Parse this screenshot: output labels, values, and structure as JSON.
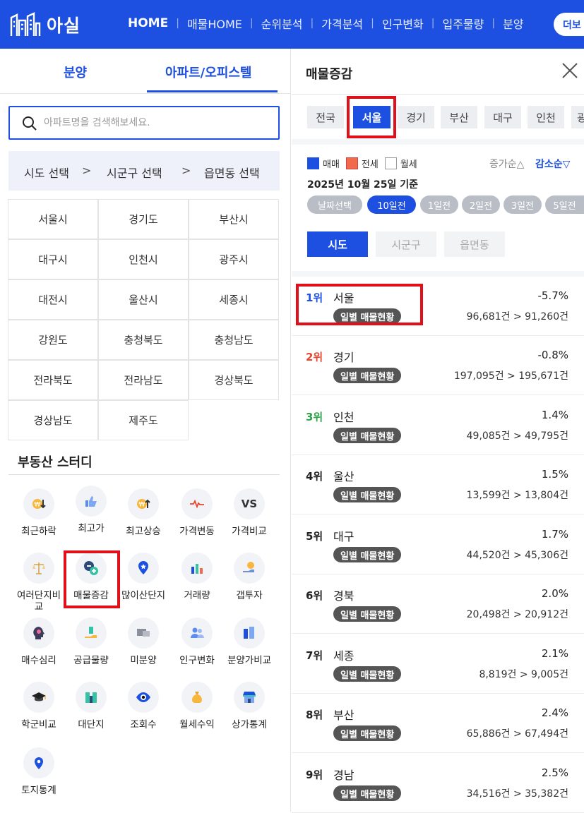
{
  "header": {
    "logo_text": "아실",
    "nav": [
      "HOME",
      "매물HOME",
      "순위분석",
      "가격분석",
      "인구변화",
      "입주물량",
      "분양"
    ],
    "more_label": "더보"
  },
  "left": {
    "tabs": [
      "분양",
      "아파트/오피스텔"
    ],
    "search_placeholder": "아파트명을 검색해보세요.",
    "region_steps": [
      "시도 선택",
      "시군구 선택",
      "읍면동 선택"
    ],
    "chevron": ">",
    "regions": [
      "서울시",
      "경기도",
      "부산시",
      "대구시",
      "인천시",
      "광주시",
      "대전시",
      "울산시",
      "세종시",
      "강원도",
      "충청북도",
      "충청남도",
      "전라북도",
      "전라남도",
      "경상북도",
      "경상남도",
      "제주도"
    ],
    "study_title": "부동산 스터디",
    "study_items": [
      "최근하락",
      "최고가",
      "최고상승",
      "가격변동",
      "가격비교",
      "여러단지비교",
      "매물증감",
      "많이산단지",
      "거래량",
      "갭투자",
      "매수심리",
      "공급물량",
      "미분양",
      "인구변화",
      "분양가비교",
      "학군비교",
      "대단지",
      "조회수",
      "월세수익",
      "상가통계",
      "토지통계"
    ],
    "vs_text": "VS"
  },
  "right": {
    "title": "매물증감",
    "region_chips": [
      "전국",
      "서울",
      "경기",
      "부산",
      "대구",
      "인천",
      "광"
    ],
    "selected_chip": "서울",
    "legend": [
      "매매",
      "전세",
      "월세"
    ],
    "legend_colors": {
      "sale": "#1d4fe0",
      "jeonse": "#f06a4b",
      "monthly": "#ffffff"
    },
    "sort": [
      "증가순△",
      "감소순▽"
    ],
    "date_text": "2025년 10월 25일 기준",
    "date_chips": [
      "날짜선택",
      "10일전",
      "1일전",
      "2일전",
      "3일전",
      "5일전"
    ],
    "level_tabs": [
      "시도",
      "시군구",
      "읍면동"
    ],
    "badge_label": "일별 매물현황",
    "rows": [
      {
        "rank": "1위",
        "name": "서울",
        "pct": "-5.7%",
        "count": "96,681건 > 91,260건",
        "rank_color": "#1d4fe0"
      },
      {
        "rank": "2위",
        "name": "경기",
        "pct": "-0.8%",
        "count": "197,095건 > 195,671건",
        "rank_color": "#e8452f"
      },
      {
        "rank": "3위",
        "name": "인천",
        "pct": "1.4%",
        "count": "49,085건 > 49,795건",
        "rank_color": "#2ea34a"
      },
      {
        "rank": "4위",
        "name": "울산",
        "pct": "1.5%",
        "count": "13,599건 > 13,804건",
        "rank_color": "#222222"
      },
      {
        "rank": "5위",
        "name": "대구",
        "pct": "1.7%",
        "count": "44,520건 > 45,306건",
        "rank_color": "#222222"
      },
      {
        "rank": "6위",
        "name": "경북",
        "pct": "2.0%",
        "count": "20,498건 > 20,912건",
        "rank_color": "#222222"
      },
      {
        "rank": "7위",
        "name": "세종",
        "pct": "2.1%",
        "count": "8,819건 > 9,005건",
        "rank_color": "#222222"
      },
      {
        "rank": "8위",
        "name": "부산",
        "pct": "2.4%",
        "count": "65,886건 > 67,494건",
        "rank_color": "#222222"
      },
      {
        "rank": "9위",
        "name": "경남",
        "pct": "2.5%",
        "count": "34,516건 > 35,382건",
        "rank_color": "#222222"
      }
    ]
  }
}
